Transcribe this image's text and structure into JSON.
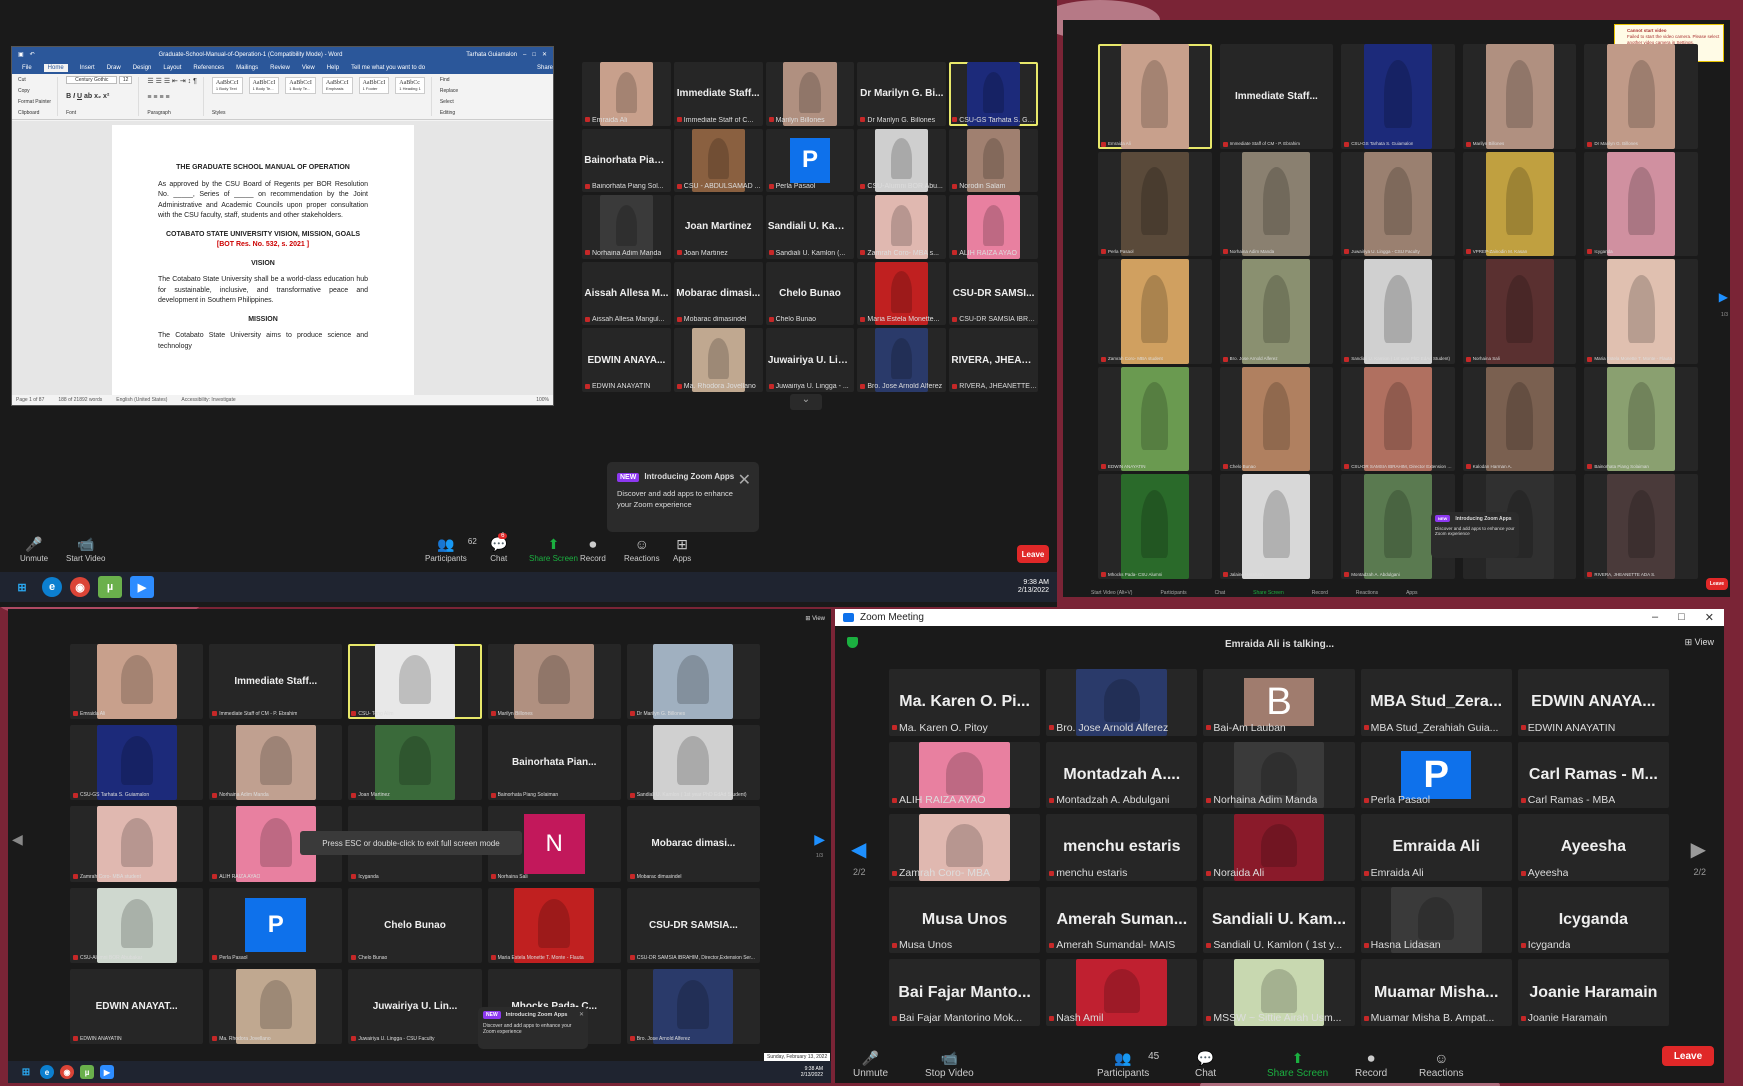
{
  "q1": {
    "word": {
      "title": "Graduate-School-Manual-of-Operation-1 (Compatibility Mode) - Word",
      "user": "Tarhata Guiamalon",
      "menu": [
        "File",
        "Home",
        "Insert",
        "Draw",
        "Design",
        "Layout",
        "References",
        "Mailings",
        "Review",
        "View",
        "Help",
        "Tell me what you want to do",
        "Share"
      ],
      "clipboard": [
        "Cut",
        "Copy",
        "Format Painter",
        "Paste",
        "Clipboard"
      ],
      "font": {
        "name": "Century Gothic",
        "size": "12",
        "label": "Font"
      },
      "paragraph_label": "Paragraph",
      "styles": [
        [
          "AaBbCcI",
          "1 Body Text"
        ],
        [
          "AaBbCcI",
          "1 Body Te..."
        ],
        [
          "AaBbCcI",
          "1 Body Te..."
        ],
        [
          "AaBbCcI",
          "Emphasis"
        ],
        [
          "AaBbCcI",
          "1 Footer"
        ],
        [
          "AaBbCc",
          "1 Heading 1"
        ]
      ],
      "styles_label": "Styles",
      "editing": [
        "Find",
        "Replace",
        "Select",
        "Editing"
      ],
      "doc": {
        "title": "THE GRADUATE SCHOOL MANUAL OF OPERATION",
        "p1": "As approved by the CSU Board of Regents per BOR Resolution No. _____, Series of _____ on recommendation by the Joint Administrative and Academic Councils upon proper consultation with the CSU faculty, staff, students and other stakeholders.",
        "h2": "COTABATO STATE UNIVERSITY VISION, MISSION, GOALS",
        "bor": "[BOT Res. No. 532, s. 2021 ]",
        "vision": "VISION",
        "p2": "The Cotabato State University shall be a world-class education hub for sustainable, inclusive, and transformative peace and development in Southern Philippines.",
        "mission": "MISSION",
        "p3": "The Cotabato State University aims to produce science and technology"
      },
      "status": [
        "Page 1 of 87",
        "188 of 21892 words",
        "English (United States)",
        "Accessibility: Investigate",
        "100%"
      ]
    },
    "tiles": [
      {
        "big": "",
        "nm": "Emraida Ali",
        "photo": "#c8a08c"
      },
      {
        "big": "Immediate Staff...",
        "nm": "Immediate Staff of C..."
      },
      {
        "big": "",
        "nm": "Marilyn Billones",
        "photo": "#b09080"
      },
      {
        "big": "Dr Marilyn G. Bi...",
        "nm": "Dr Marilyn G. Billones"
      },
      {
        "big": "",
        "nm": "CSU-GS Tarhata S. Guia...",
        "photo": "#1c2a7a",
        "hl": true
      },
      {
        "big": "Bainorhata Pian...",
        "nm": "Bainorhata Piang Sol..."
      },
      {
        "big": "",
        "nm": "CSU - ABDULSAMAD ...",
        "photo": "#8a6040"
      },
      {
        "big": "",
        "nm": "Perla Pasaol",
        "p": "P"
      },
      {
        "big": "",
        "nm": "CSU-Alumni BOR Abu...",
        "photo": "#cfcfcf"
      },
      {
        "big": "",
        "nm": "Norodin Salam",
        "photo": "#a08070"
      },
      {
        "big": "",
        "nm": "Norhaina Adim Manda",
        "photo": "#3a3a3a"
      },
      {
        "big": "Joan Martinez",
        "nm": "Joan Martinez"
      },
      {
        "big": "Sandiali U. Kaml...",
        "nm": "Sandiali U. Kamlon (..."
      },
      {
        "big": "",
        "nm": "Zamrah Coro- MBA s...",
        "photo": "#e0b8b0"
      },
      {
        "big": "",
        "nm": "ALIH RAIZA AYAO",
        "photo": "#e880a0"
      },
      {
        "big": "Aissah Allesa M...",
        "nm": "Aissah Allesa Mangul..."
      },
      {
        "big": "Mobarac dimasi...",
        "nm": "Mobarac dimasindel"
      },
      {
        "big": "Chelo Bunao",
        "nm": "Chelo Bunao"
      },
      {
        "big": "",
        "nm": "Maria Estela Monette...",
        "photo": "#c02020"
      },
      {
        "big": "CSU-DR SAMSI...",
        "nm": "CSU-DR SAMSIA IBRA..."
      },
      {
        "big": "EDWIN ANAYA...",
        "nm": "EDWIN ANAYATIN"
      },
      {
        "big": "",
        "nm": "Ma. Rhodora Jovellano",
        "photo": "#c0a890"
      },
      {
        "big": "Juwairiya U. Lin...",
        "nm": "Juwairiya U. Lingga - ..."
      },
      {
        "big": "",
        "nm": "Bro. Jose Arnold Alferez",
        "photo": "#2a3a6a"
      },
      {
        "big": "RIVERA, JHEAN...",
        "nm": "RIVERA, JHEANETTE ..."
      }
    ],
    "popup": {
      "new": "NEW",
      "title": "Introducing Zoom Apps",
      "body": "Discover and add apps to enhance your Zoom experience"
    },
    "toolbar": [
      {
        "label": "Unmute",
        "icon": "🎤"
      },
      {
        "label": "Start Video",
        "icon": "📹"
      },
      {
        "label": "Participants",
        "icon": "👥",
        "count": "62"
      },
      {
        "label": "Chat",
        "icon": "💬",
        "badge": "6"
      },
      {
        "label": "Share Screen",
        "icon": "⬆"
      },
      {
        "label": "Record",
        "icon": "⏺"
      },
      {
        "label": "Reactions",
        "icon": "☺"
      },
      {
        "label": "Apps",
        "icon": "⊞"
      }
    ],
    "leave": "Leave",
    "clock": {
      "time": "9:38 AM",
      "date": "2/13/2022"
    }
  },
  "q2": {
    "warning": {
      "title": "Cannot start video",
      "body": "Failed to start the video camera. Please select another video camera in Settings."
    },
    "tiles": [
      {
        "nm": "Emraida Ali",
        "photo": "#c8a08c",
        "hl": true
      },
      {
        "nm": "Immediate Staff of CM - P. Ebrahim",
        "big": "Immediate Staff..."
      },
      {
        "nm": "CSU-GS Tarhata S. Guiamalon",
        "photo": "#1c2a7a"
      },
      {
        "nm": "Marilyn Billones",
        "photo": "#b09080"
      },
      {
        "nm": "Dr Marilyn G. Billones",
        "photo": "#c09a88"
      },
      {
        "nm": "Perla Pasaol",
        "photo": "#5a4a3a"
      },
      {
        "nm": "Norhaina Adim Manda",
        "photo": "#8a8070"
      },
      {
        "nm": "Juwairiya U. Lingga - CSU Faculty",
        "photo": "#9a8070"
      },
      {
        "nm": "VPREP-Zainodin M. Kasan",
        "photo": "#c0a040"
      },
      {
        "nm": "Icyganda",
        "photo": "#d090a0"
      },
      {
        "nm": "Zamrah Coro- MBA student",
        "photo": "#d0a060"
      },
      {
        "nm": "Bro. Jose Arnold Alferez",
        "photo": "#8a9070"
      },
      {
        "nm": "Sandiali U. Kamlon ( 1st year PhD EdAd Student)",
        "photo": "#d0d0d0"
      },
      {
        "nm": "Norhaina Sali",
        "photo": "#5a3030"
      },
      {
        "nm": "Maria Estela Monette T. Monte - Flauta",
        "photo": "#e0c0b0"
      },
      {
        "nm": "EDWIN ANAYATIN",
        "photo": "#6a9a50"
      },
      {
        "nm": "Chelo Bunao",
        "photo": "#b08060"
      },
      {
        "nm": "CSU-DR SAMSIA IBRAHIM, Director Extension Ser...",
        "photo": "#b07060"
      },
      {
        "nm": "Kalodan Harman A.",
        "photo": "#7a6050"
      },
      {
        "nm": "Bainorhata Piang Solaiman",
        "photo": "#8aa070"
      },
      {
        "nm": "Mhocks Pada- CSU Alumni",
        "photo": "#2a6a2a"
      },
      {
        "nm": "Jalaine Haraham",
        "photo": "#d8d8d8"
      },
      {
        "nm": "Montadzah A. Abdulgani",
        "photo": "#5a7a50"
      },
      {
        "nm": "",
        "photo": "#303030"
      },
      {
        "nm": "RIVERA, JHEANETTE ADA S.",
        "photo": "#4a3a3a"
      }
    ],
    "popup": {
      "new": "NEW",
      "title": "Introducing Zoom Apps",
      "body": "Discover and add apps to enhance your Zoom experience"
    },
    "toolbar": [
      "Start Video (Alt+V)",
      "Participants",
      "Chat",
      "Share Screen",
      "Record",
      "Reactions",
      "Apps"
    ],
    "leave": "Leave",
    "page": "1/3"
  },
  "q3": {
    "view": "View",
    "tiles": [
      {
        "nm": "Emraida Ali",
        "photo": "#c8a08c"
      },
      {
        "nm": "Immediate Staff of CM - P. Ebrahim",
        "big": "Immediate Staff..."
      },
      {
        "nm": "CSU- Teng Alim",
        "photo": "#e8e8e8",
        "hl": true
      },
      {
        "nm": "Marilyn Billones",
        "photo": "#b09080"
      },
      {
        "nm": "Dr Marilyn G. Billones",
        "photo": "#a0b0c0"
      },
      {
        "nm": "CSU-GS Tarhata S. Guiamalon",
        "photo": "#1c2a7a"
      },
      {
        "nm": "Norhaina Adim Manda",
        "photo": "#c0a090"
      },
      {
        "nm": "Joan Martinez",
        "photo": "#3a6a3a"
      },
      {
        "nm": "Bainorhata Piang Solaiman",
        "big": "Bainorhata Pian..."
      },
      {
        "nm": "Sandiali U. Kamlon ( 1st year PhD EdAd Student)",
        "photo": "#d0d0d0"
      },
      {
        "nm": "Zamrah Coro- MBA student",
        "photo": "#e0b8b0"
      },
      {
        "nm": "ALIH RAIZA AYAO",
        "photo": "#e880a0"
      },
      {
        "nm": "Icyganda",
        "big": ""
      },
      {
        "nm": "Norhaina Sali",
        "n": "N"
      },
      {
        "nm": "Mobarac dimasindel",
        "big": "Mobarac dimasi..."
      },
      {
        "nm": "CSU-Alumni BOR Abubakar",
        "photo": "#cfd8cf"
      },
      {
        "nm": "Perla Pasaol",
        "p": "P"
      },
      {
        "nm": "Chelo Bunao",
        "big": "Chelo Bunao"
      },
      {
        "nm": "Maria Estela Monette T. Monte - Flauta",
        "photo": "#c02020"
      },
      {
        "nm": "CSU-DR SAMSIA IBRAHIM, Director,Extension Ser...",
        "big": "CSU-DR SAMSIA..."
      },
      {
        "nm": "EDWIN ANAYATIN",
        "big": "EDWIN ANAYAT..."
      },
      {
        "nm": "Ma. Rhodora Jovellano",
        "photo": "#c0a890"
      },
      {
        "nm": "Juwairiya U. Lingga - CSU Faculty",
        "big": "Juwairiya U. Lin..."
      },
      {
        "nm": "",
        "big": "Mhocks Pada- C..."
      },
      {
        "nm": "Bro. Jose Arnold Alferez",
        "photo": "#2a3a6a"
      }
    ],
    "toast": "Press ESC or double-click to exit full screen mode",
    "popup": {
      "new": "NEW",
      "title": "Introducing Zoom Apps",
      "body": "Discover and add apps to enhance your Zoom experience"
    },
    "page": "1/3",
    "datebox": "Sunday, February 13, 2022",
    "clock": {
      "time": "9:38 AM",
      "date": "2/13/2022"
    }
  },
  "q4": {
    "title": "Zoom Meeting",
    "talking": "Emraida Ali is talking...",
    "view": "View",
    "page_left": "2/2",
    "page_right": "2/2",
    "tiles": [
      {
        "big": "Ma. Karen O. Pi...",
        "nm": "Ma. Karen O. Pitoy"
      },
      {
        "big": "",
        "nm": "Bro. Jose Arnold Alferez",
        "photo": "#2a3a6a"
      },
      {
        "big": "",
        "nm": "Bai-Am Lauban",
        "b": "B"
      },
      {
        "big": "MBA Stud_Zera...",
        "nm": "MBA Stud_Zerahiah Guia..."
      },
      {
        "big": "EDWIN ANAYA...",
        "nm": "EDWIN ANAYATIN"
      },
      {
        "big": "",
        "nm": "ALIH RAIZA AYAO",
        "photo": "#e880a0"
      },
      {
        "big": "Montadzah A....",
        "nm": "Montadzah A. Abdulgani"
      },
      {
        "big": "",
        "nm": "Norhaina Adim Manda",
        "photo": "#3a3a3a"
      },
      {
        "big": "",
        "nm": "Perla Pasaol",
        "p": "P"
      },
      {
        "big": "Carl Ramas - M...",
        "nm": "Carl Ramas - MBA"
      },
      {
        "big": "",
        "nm": "Zamrah Coro- MBA",
        "photo": "#e0b8b0"
      },
      {
        "big": "menchu estaris",
        "nm": "menchu estaris"
      },
      {
        "big": "",
        "nm": "Noraida Ali",
        "photo": "#8a1a2a"
      },
      {
        "big": "Emraida Ali",
        "nm": "Emraida Ali"
      },
      {
        "big": "Ayeesha",
        "nm": "Ayeesha"
      },
      {
        "big": "Musa Unos",
        "nm": "Musa Unos"
      },
      {
        "big": "Amerah Suman...",
        "nm": "Amerah Sumandal- MAIS"
      },
      {
        "big": "Sandiali U. Kam...",
        "nm": "Sandiali U. Kamlon ( 1st y..."
      },
      {
        "big": "",
        "nm": "Hasna Lidasan",
        "photo": "#3a3a3a"
      },
      {
        "big": "Icyganda",
        "nm": "Icyganda"
      },
      {
        "big": "Bai Fajar Manto...",
        "nm": "Bai Fajar Mantorino Mok..."
      },
      {
        "big": "",
        "nm": "Nash Amil",
        "photo": "#c02030"
      },
      {
        "big": "",
        "nm": "MSSW ~ Sittie Airah Usm...",
        "photo": "#c8d8b0"
      },
      {
        "big": "Muamar Misha...",
        "nm": "Muamar Misha B. Ampat..."
      },
      {
        "big": "Joanie Haramain",
        "nm": "Joanie Haramain"
      }
    ],
    "toolbar": [
      {
        "label": "Unmute",
        "icon": "🎤"
      },
      {
        "label": "Stop Video",
        "icon": "📹"
      },
      {
        "label": "Participants",
        "icon": "👥",
        "count": "45"
      },
      {
        "label": "Chat",
        "icon": "💬"
      },
      {
        "label": "Share Screen",
        "icon": "⬆"
      },
      {
        "label": "Record",
        "icon": "⏺"
      },
      {
        "label": "Reactions",
        "icon": "☺"
      }
    ],
    "leave": "Leave"
  }
}
